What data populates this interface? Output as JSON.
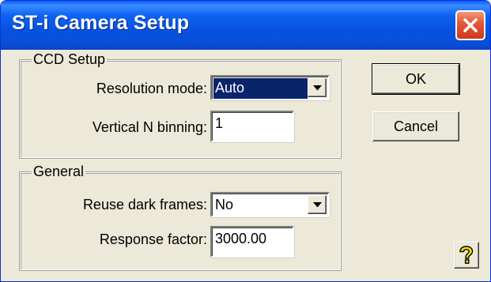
{
  "window": {
    "title": "ST-i Camera Setup"
  },
  "ccd_setup": {
    "group_label": "CCD Setup",
    "resolution_mode_label": "Resolution mode:",
    "resolution_mode_value": "Auto",
    "vertical_binning_label": "Vertical N binning:",
    "vertical_binning_value": "1"
  },
  "general": {
    "group_label": "General",
    "reuse_dark_frames_label": "Reuse dark frames:",
    "reuse_dark_frames_value": "No",
    "response_factor_label": "Response factor:",
    "response_factor_value": "3000.00"
  },
  "buttons": {
    "ok_label": "OK",
    "cancel_label": "Cancel"
  },
  "icons": {
    "close": "close-icon",
    "dropdown": "chevron-down-icon",
    "help": "help-icon"
  },
  "colors": {
    "titlebar": "#0a58e8",
    "dialog_bg": "#ece9d8",
    "selection": "#0a246a",
    "close_button": "#d94a2a"
  }
}
